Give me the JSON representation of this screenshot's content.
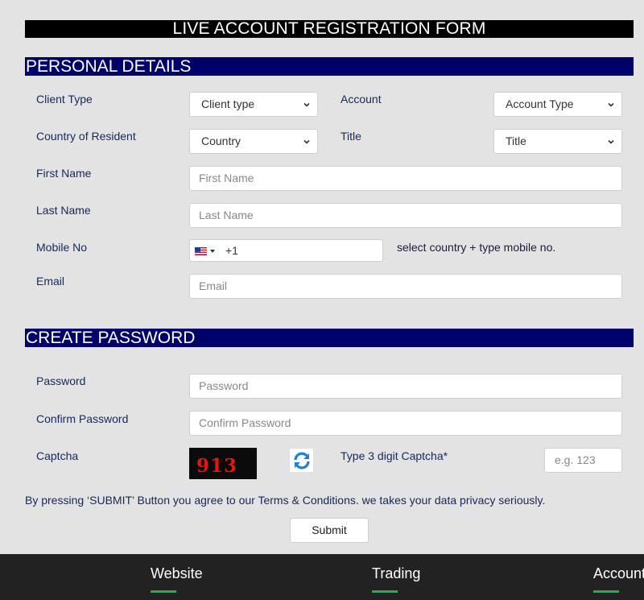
{
  "form": {
    "title": "LIVE ACCOUNT REGISTRATION FORM"
  },
  "personal": {
    "heading": "PERSONAL DETAILS",
    "client_type": {
      "label": "Client Type",
      "value": "Client type"
    },
    "account": {
      "label": "Account",
      "value": "Account Type"
    },
    "country": {
      "label": "Country of Resident",
      "value": "Country"
    },
    "title": {
      "label": "Title",
      "value": "Title"
    },
    "first_name": {
      "label": "First Name",
      "placeholder": "First Name"
    },
    "last_name": {
      "label": "Last Name",
      "placeholder": "Last Name"
    },
    "mobile": {
      "label": "Mobile No",
      "dial_code": "+1",
      "flag": "us-flag-icon",
      "hint": "select country + type mobile no."
    },
    "email": {
      "label": "Email",
      "placeholder": "Email"
    }
  },
  "password_section": {
    "heading": "CREATE PASSWORD",
    "password": {
      "label": "Password",
      "placeholder": "Password"
    },
    "confirm": {
      "label": "Confirm Password",
      "placeholder": "Confirm Password"
    },
    "captcha": {
      "label": "Captcha",
      "image_text": "913",
      "hint": "Type 3 digit Captcha*",
      "placeholder": "e.g. 123"
    }
  },
  "agreement": "By pressing ‘SUBMIT’ Button you agree to our Terms & Conditions. we takes your data privacy seriously.",
  "submit_label": "Submit",
  "footer": {
    "links": [
      "Website",
      "Trading",
      "Accounts"
    ]
  },
  "colors": {
    "title_bar": "#000000",
    "section_bar": "#00006b",
    "background": "#e3e3e3",
    "footer": "#222222",
    "footer_accent": "#1fb14a",
    "captcha_text": "#e3180c"
  }
}
